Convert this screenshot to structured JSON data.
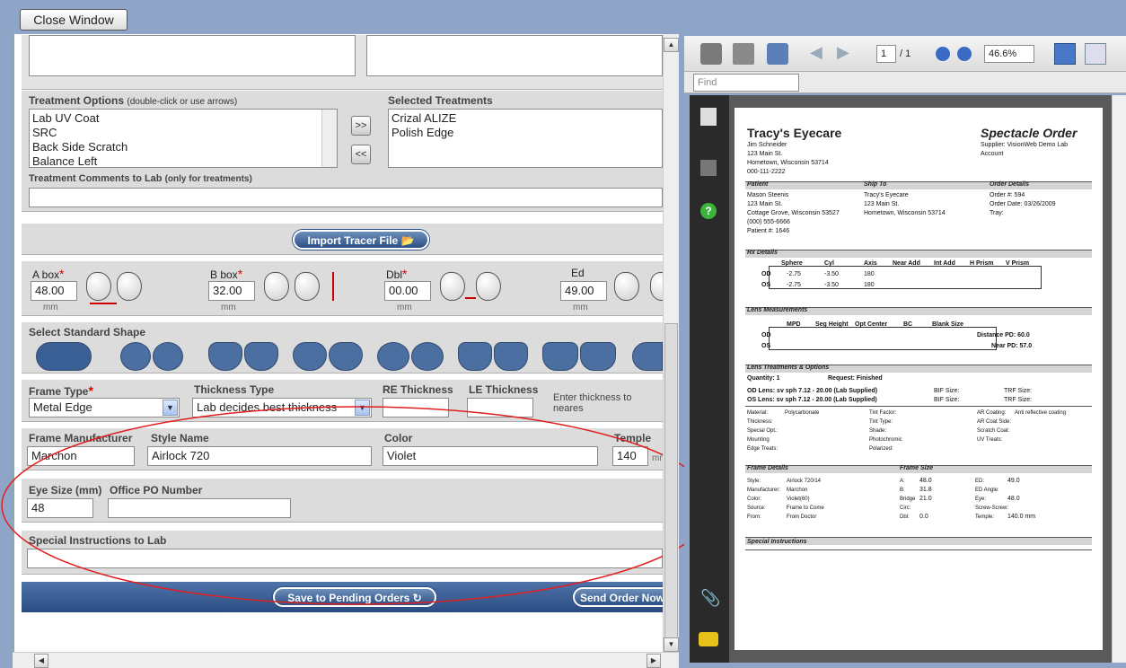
{
  "window": {
    "close_label": "Close Window"
  },
  "treatments": {
    "options_label": "Treatment Options",
    "options_hint": "(double-click or use arrows)",
    "selected_label": "Selected Treatments",
    "options": [
      "Lab UV Coat",
      "SRC",
      "Back Side Scratch",
      "Balance Left"
    ],
    "selected": [
      "Crizal ALIZE",
      "Polish Edge"
    ],
    "add_label": ">>",
    "remove_label": "<<",
    "comments_label": "Treatment Comments to Lab",
    "comments_hint": "(only for treatments)"
  },
  "tracer": {
    "import_label": "Import Tracer File"
  },
  "measurements": {
    "abox_label": "A box",
    "abox_value": "48.00",
    "bbox_label": "B box",
    "bbox_value": "32.00",
    "dbl_label": "Dbl",
    "dbl_value": "00.00",
    "ed_label": "Ed",
    "ed_value": "49.00",
    "unit": "mm"
  },
  "shape": {
    "label": "Select Standard Shape"
  },
  "frame": {
    "type_label": "Frame Type",
    "type_value": "Metal Edge",
    "thickness_label": "Thickness Type",
    "thickness_value": "Lab decides best thickness",
    "re_label": "RE Thickness",
    "le_label": "LE Thickness",
    "thickness_hint": "Enter thickness to neares",
    "mfr_label": "Frame Manufacturer",
    "mfr_value": "Marchon",
    "style_label": "Style Name",
    "style_value": "Airlock 720",
    "color_label": "Color",
    "color_value": "Violet",
    "temple_label": "Temple Le",
    "temple_value": "140",
    "temple_unit": "mm",
    "eyesize_label": "Eye Size (mm)",
    "eyesize_value": "48",
    "po_label": "Office PO Number"
  },
  "instructions": {
    "label": "Special Instructions to Lab"
  },
  "actions": {
    "save_label": "Save to Pending Orders",
    "send_label": "Send Order Now"
  },
  "pdf": {
    "page_current": "1",
    "page_total": "/ 1",
    "zoom": "46.6%",
    "find_placeholder": "Find",
    "doc": {
      "company": "Tracy's Eyecare",
      "title": "Spectacle Order",
      "addr": [
        "Jim Schneider",
        "123 Main St.",
        "Hometown, Wisconsin 53714",
        "000-111-2222"
      ],
      "supplier": "Supplier:  VisionWeb Demo Lab",
      "account": "Account",
      "patient_h": "Patient",
      "shipto_h": "Ship To",
      "orderdetails_h": "Order Details",
      "patient": [
        "Mason Steenis",
        "123 Main St.",
        "Cottage Grove, Wisconsin 53527",
        "(000) 555-6666",
        "Patient #:  1646"
      ],
      "shipto": [
        "Tracy's Eyecare",
        "123 Main St.",
        "Hometown, Wisconsin 53714"
      ],
      "order": [
        "Order #:     594",
        "Order Date:  03/26/2009",
        "Tray:"
      ],
      "rx_h": "Rx Details",
      "rx_cols": [
        "Sphere",
        "Cyl",
        "Axis",
        "Near Add",
        "Int Add",
        "H Prism",
        "V Prism"
      ],
      "rx_od": [
        "OD",
        "-2.75",
        "-3.50",
        "180"
      ],
      "rx_os": [
        "OS",
        "-2.75",
        "-3.50",
        "180"
      ],
      "lm_h": "Lens Measurements",
      "lm_cols": [
        "MPD",
        "Seg Height",
        "Opt Center",
        "BC",
        "Blank Size"
      ],
      "distance_pd": "Distance PD:   60.0",
      "near_pd": "Near PD:   57.0",
      "lt_h": "Lens Treatments & Options",
      "quantity": "Quantity:   1",
      "request": "Request: Finished",
      "od_lens": "OD Lens:  sv sph 7.12 - 20.00 (Lab Supplied)",
      "os_lens": "OS Lens:  sv sph 7.12 - 20.00 (Lab Supplied)",
      "bif": "BIF Size:",
      "trf": "TRF Size:",
      "material": "Material:",
      "material_v": "Polycarbonate",
      "thickness": "Thickness:",
      "specialopt": "Special Opt.:",
      "mounting": "Mounting",
      "edge": "Edge Treats:",
      "tint": "Tint Factor:",
      "tinttype": "Tint Type:",
      "shade": "Shade:",
      "photo": "Photochromic",
      "polar": "Polarized:",
      "ar": "AR Coating:",
      "ar_v": "Anti reflective coating",
      "arside": "AR Coat Side:",
      "scratch": "Scratch Coat:",
      "uv": "UV Treats:",
      "fd_h": "Frame Details",
      "fs_h": "Frame Size",
      "fd_labels": [
        "Style:",
        "Manufacturer:",
        "Color:",
        "Source:",
        "From:"
      ],
      "fd_values": [
        "Airlock 720/14",
        "Marchon",
        "Violet(60)",
        "Frame to Come",
        "From Doctor"
      ],
      "fs_labels": [
        "A:",
        "B:",
        "Bridge",
        "Circ:",
        "Dbl:"
      ],
      "fs_values": [
        "48.0",
        "31.8",
        "21.0",
        "",
        "0.0"
      ],
      "ed_labels": [
        "ED:",
        "ED Angle:",
        "Eye:",
        "Screw-Screw:",
        "Temple:"
      ],
      "ed_values": [
        "49.0",
        "",
        "48.0",
        "",
        "140.0 mm"
      ],
      "si_h": "Special Instructions"
    }
  },
  "colors": {
    "annotation": "#e02020",
    "header_blue": "#2c4f86"
  }
}
